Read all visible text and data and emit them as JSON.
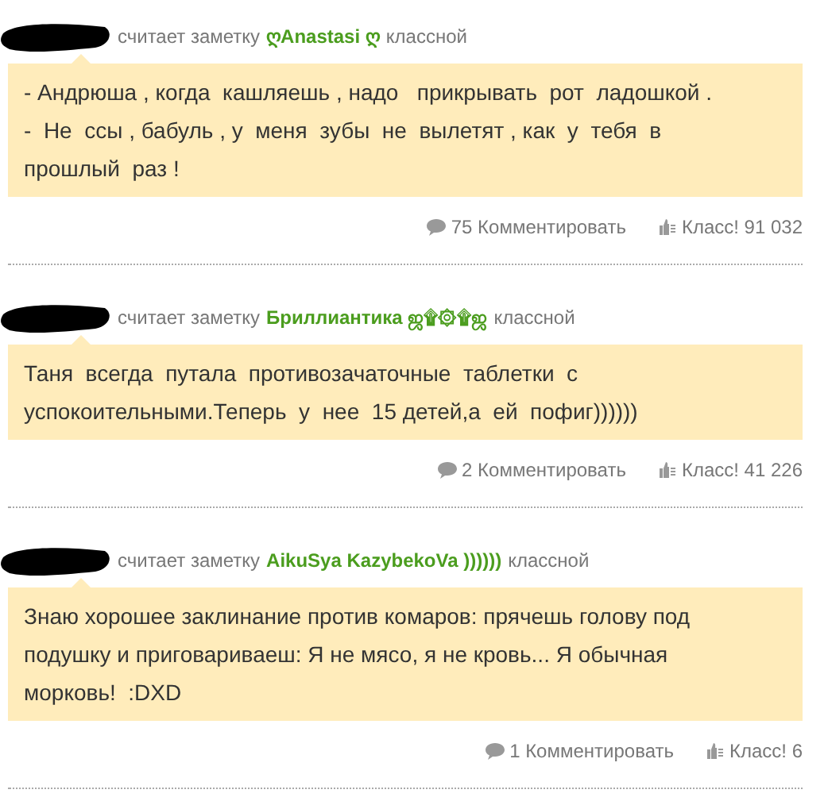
{
  "posts": [
    {
      "verb": "считает заметку",
      "author": "ღAnastasi ღ",
      "adjective": "классной",
      "text": "- Андрюша , когда  кашляешь , надо   прикрывать  рот  ладошкой . -  Не  ссы , бабуль , у  меня  зубы  не  вылетят , как  у  тебя  в  прошлый  раз !",
      "comments": "75 Комментировать",
      "likes": "Класс! 91 032"
    },
    {
      "verb": "считает заметку",
      "author": "Бриллиантика ஜ۩۞۩ஜ",
      "adjective": "классной",
      "text": "Таня  всегда  путала  противозачаточные  таблетки  с  успокоительными.Теперь  у  нее  15 детей,а  ей  пофиг))))))",
      "comments": "2 Комментировать",
      "likes": "Класс! 41 226"
    },
    {
      "verb": "считает заметку",
      "author": "AikuSya KazybekoVa ))))))",
      "adjective": "классной",
      "text": "Знаю хорошее заклинание против комаров: прячешь голову под подушку и приговариваеш: Я не мясо, я не кровь... Я обычная морковь!  :DXD",
      "comments": "1 Комментировать",
      "likes": "Класс! 6"
    }
  ]
}
